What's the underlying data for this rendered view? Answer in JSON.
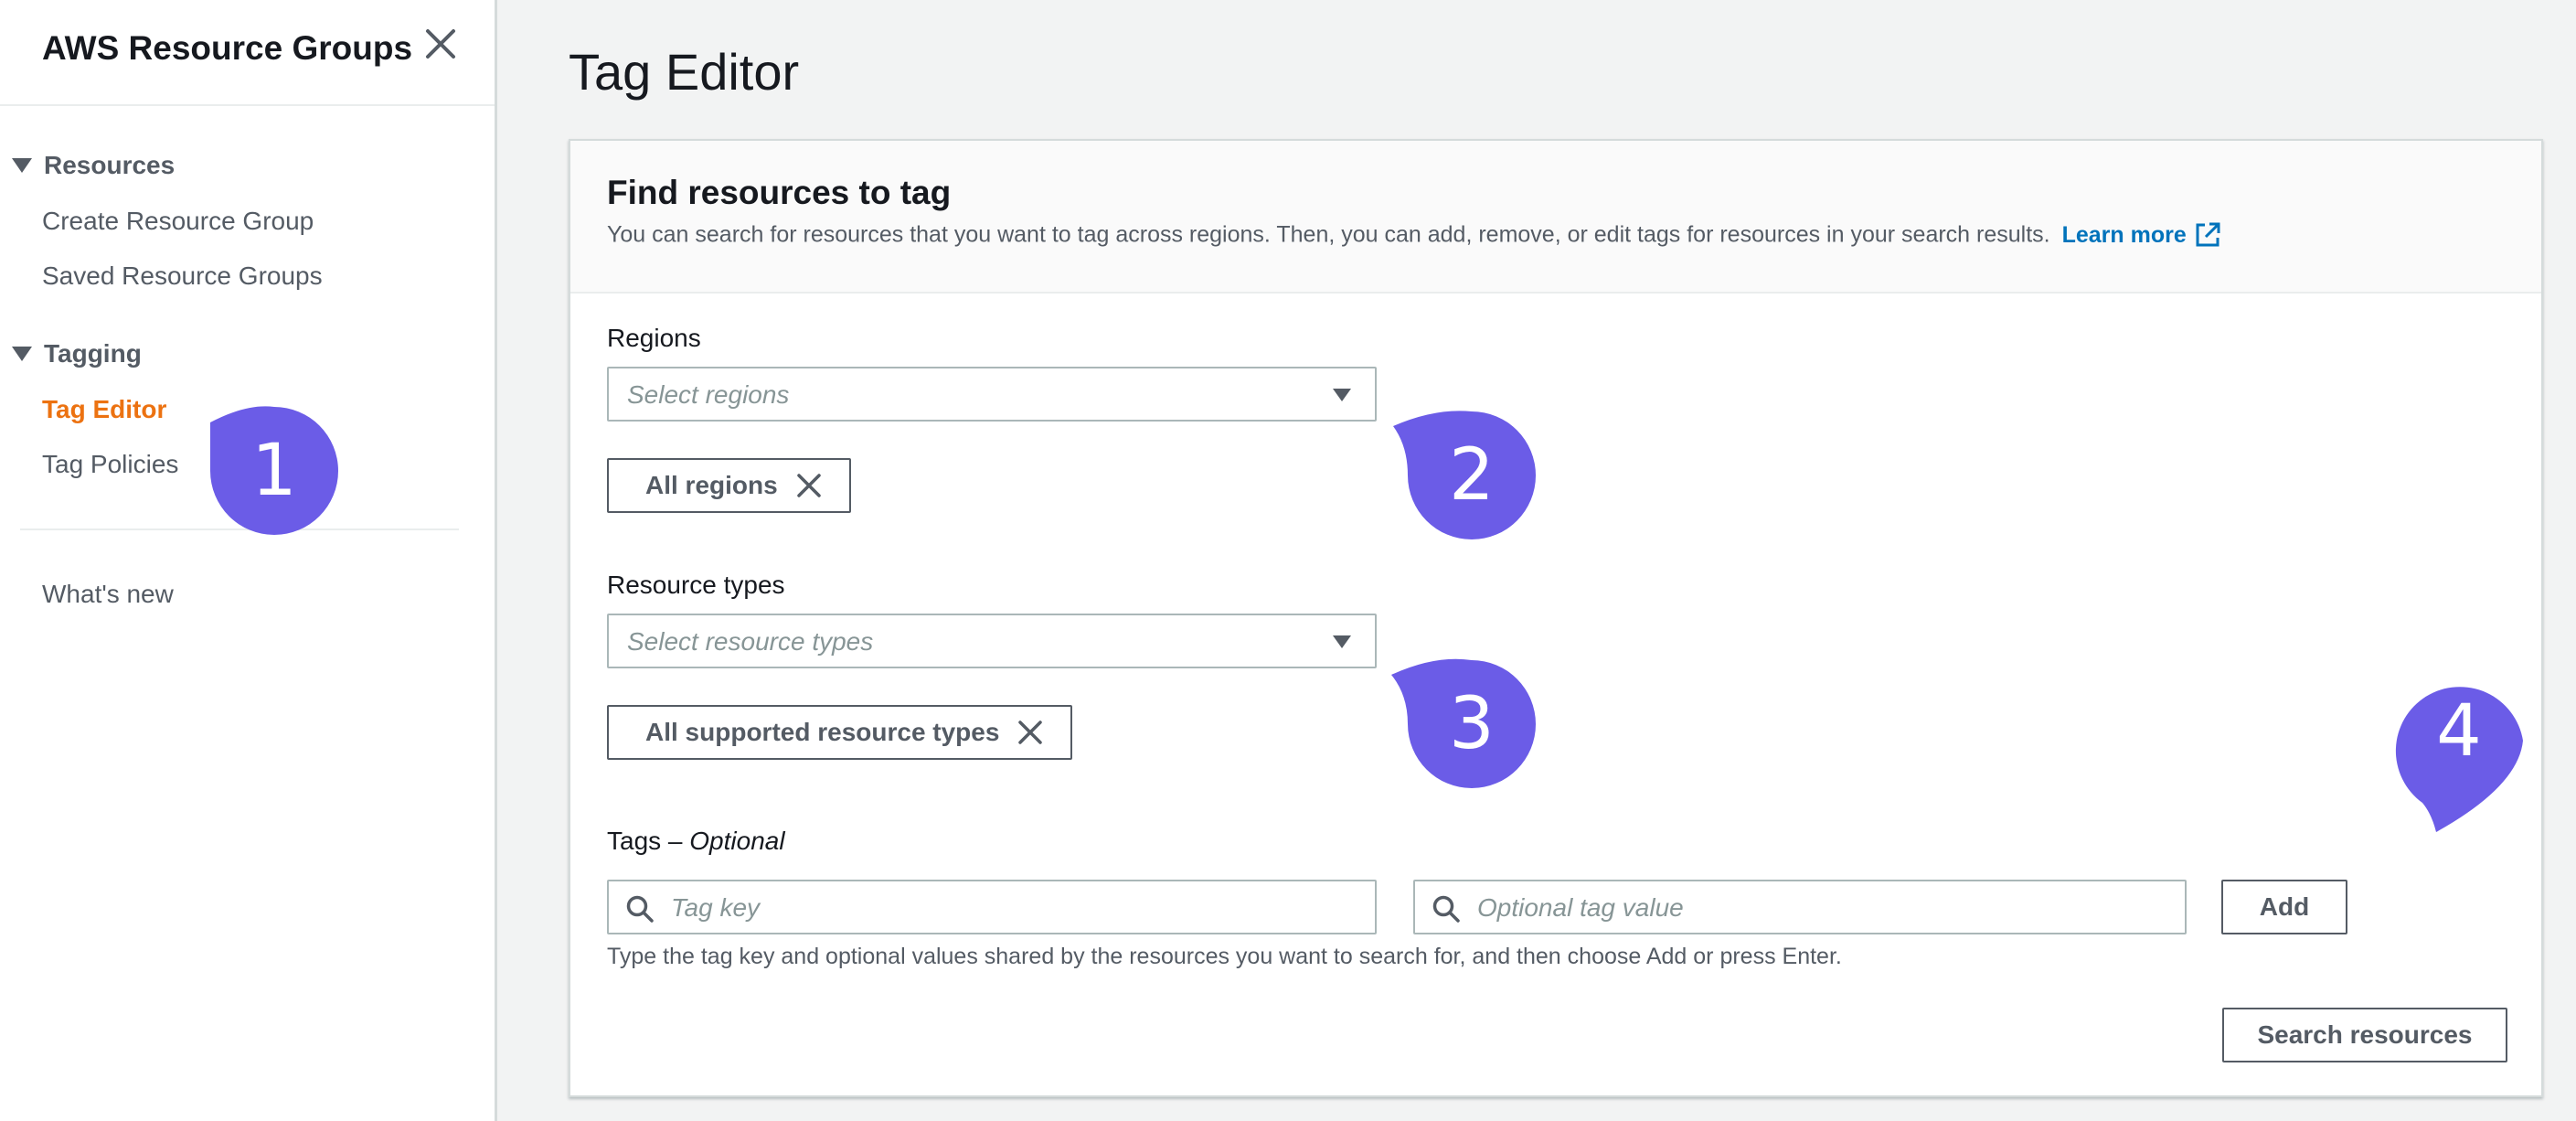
{
  "sidebar": {
    "title": "AWS Resource Groups",
    "sections": [
      {
        "label": "Resources",
        "items": [
          "Create Resource Group",
          "Saved Resource Groups"
        ]
      },
      {
        "label": "Tagging",
        "items": [
          "Tag Editor",
          "Tag Policies"
        ]
      }
    ],
    "active_item": "Tag Editor",
    "footer_item": "What's new"
  },
  "main": {
    "page_title": "Tag Editor",
    "panel": {
      "title": "Find resources to tag",
      "description": "You can search for resources that you want to tag across regions. Then, you can add, remove, or edit tags for resources in your search results.",
      "learn_more": "Learn more"
    },
    "regions": {
      "label": "Regions",
      "placeholder": "Select regions",
      "token": "All regions"
    },
    "resource_types": {
      "label": "Resource types",
      "placeholder": "Select resource types",
      "token": "All supported resource types"
    },
    "tags": {
      "label": "Tags –",
      "label_optional": "Optional",
      "key_placeholder": "Tag key",
      "value_placeholder": "Optional tag value",
      "add_button": "Add",
      "hint": "Type the tag key and optional values shared by the resources you want to search for, and then choose Add or press Enter."
    },
    "search_button": "Search resources"
  },
  "markers": [
    "1",
    "2",
    "3",
    "4"
  ],
  "colors": {
    "accent": "#ec7211",
    "link": "#0073bb",
    "marker": "#6b5ce7"
  },
  "icons": [
    "close-icon",
    "caret-down-icon",
    "external-link-icon",
    "search-icon",
    "remove-token-icon"
  ]
}
